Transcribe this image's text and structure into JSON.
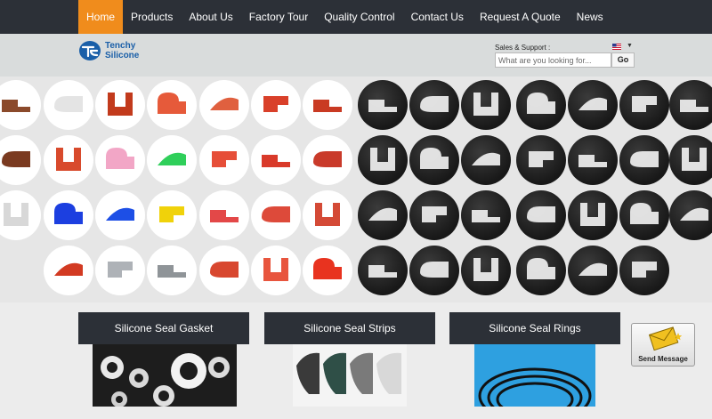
{
  "nav": {
    "items": [
      {
        "label": "Home",
        "active": true
      },
      {
        "label": "Products"
      },
      {
        "label": "About Us"
      },
      {
        "label": "Factory Tour"
      },
      {
        "label": "Quality Control"
      },
      {
        "label": "Contact Us"
      },
      {
        "label": "Request A Quote"
      },
      {
        "label": "News"
      }
    ]
  },
  "header": {
    "logo_line1": "Tenchy",
    "logo_line2": "Silicone",
    "sales_label": "Sales & Support :",
    "search_placeholder": "What are you looking for...",
    "go_label": "Go"
  },
  "categories": [
    {
      "title": "Silicone Seal Gasket"
    },
    {
      "title": "Silicone Seal Strips"
    },
    {
      "title": "Silicone Seal Rings"
    }
  ],
  "send_message": {
    "label": "Send Message"
  },
  "colors": {
    "nav_bg": "#2c3037",
    "nav_active": "#f08c1c",
    "header_bg": "#d9dcdc",
    "logo_blue": "#1a5fa8"
  }
}
